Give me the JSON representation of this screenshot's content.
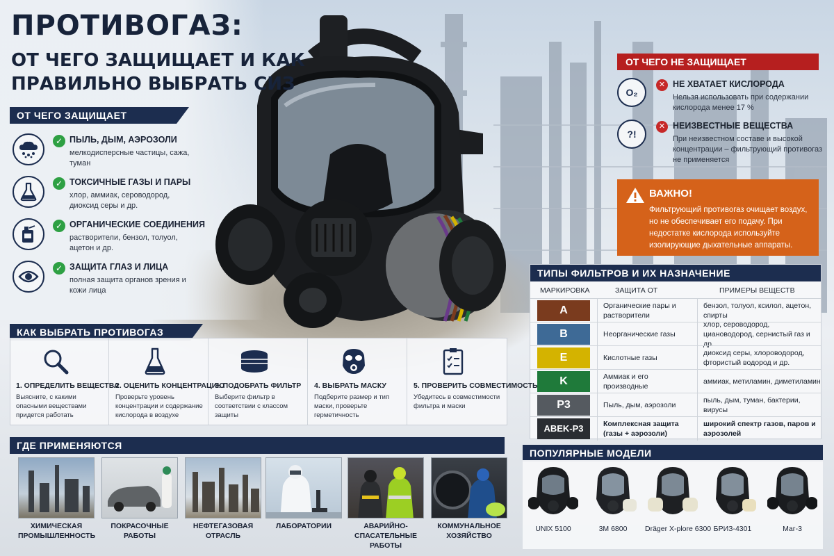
{
  "title": {
    "line1": "ПРОТИВОГАЗ:",
    "line2": "ОТ ЧЕГО ЗАЩИЩАЕТ И КАК",
    "line3": "ПРАВИЛЬНО ВЫБРАТЬ СИЗ"
  },
  "protects": {
    "header": "ОТ ЧЕГО ЗАЩИЩАЕТ",
    "items": [
      {
        "icon": "dust-cloud-icon",
        "title": "ПЫЛЬ, ДЫМ, АЭРОЗОЛИ",
        "desc": "мелкодисперсные частицы, сажа, туман"
      },
      {
        "icon": "flask-icon",
        "title": "ТОКСИЧНЫЕ ГАЗЫ И ПАРЫ",
        "desc": "хлор, аммиак, сероводород, диоксид серы и др."
      },
      {
        "icon": "solvent-can-icon",
        "title": "ОРГАНИЧЕСКИЕ СОЕДИНЕНИЯ",
        "desc": "растворители, бензол, толуол, ацетон и др."
      },
      {
        "icon": "eye-icon",
        "title": "ЗАЩИТА ГЛАЗ И ЛИЦА",
        "desc": "полная защита органов зрения и кожи лица"
      }
    ]
  },
  "not_protects": {
    "header": "ОТ ЧЕГО НЕ ЗАЩИЩАЕТ",
    "items": [
      {
        "icon_text": "O₂",
        "title": "НЕ ХВАТАЕТ КИСЛОРОДА",
        "desc": "Нельзя использовать при содержании кислорода менее 17 %"
      },
      {
        "icon_text": "?!",
        "title": "НЕИЗВЕСТНЫЕ ВЕЩЕСТВА",
        "desc": "При неизвестном составе и высокой концентрации – фильтрующий противогаз не применяется"
      }
    ]
  },
  "warning": {
    "title": "ВАЖНО!",
    "text": "Фильтрующий противогаз очищает воздух, но не обеспечивает его подачу. При недостатке кислорода используйте изолирующие дыхательные аппараты."
  },
  "filters": {
    "header": "ТИПЫ ФИЛЬТРОВ И ИХ НАЗНАЧЕНИЕ",
    "columns": [
      "МАРКИРОВКА",
      "ЗАЩИТА ОТ",
      "ПРИМЕРЫ ВЕЩЕСТВ"
    ],
    "rows": [
      {
        "mark": "A",
        "color": "#7a3b1e",
        "protect": "Органические пары и растворители",
        "examples": "бензол, толуол, ксилол, ацетон, спирты"
      },
      {
        "mark": "B",
        "color": "#3e6a96",
        "protect": "Неорганические газы",
        "examples": "хлор, сероводород, циановодород, сернистый газ и др."
      },
      {
        "mark": "E",
        "color": "#d4b300",
        "protect": "Кислотные газы",
        "examples": "диоксид серы, хлороводород, фтористый водород и др."
      },
      {
        "mark": "K",
        "color": "#1f7a3a",
        "protect": "Аммиак и его производные",
        "examples": "аммиак, метиламин, диметиламин"
      },
      {
        "mark": "P3",
        "color": "#555a60",
        "protect": "Пыль, дым, аэрозоли",
        "examples": "пыль, дым, туман, бактерии, вирусы"
      },
      {
        "mark": "ABEK-P3",
        "color": "#2a2d32",
        "protect": "Комплексная защита (газы + аэрозоли)",
        "examples": "широкий спектр газов, паров и аэрозолей"
      }
    ]
  },
  "choose": {
    "header": "КАК ВЫБРАТЬ ПРОТИВОГАЗ",
    "steps": [
      {
        "icon": "magnifier-icon",
        "title": "1. ОПРЕДЕЛИТЬ ВЕЩЕСТВА",
        "desc": "Выясните, с какими опасными веществами придется работать"
      },
      {
        "icon": "flask-icon",
        "title": "2. ОЦЕНИТЬ КОНЦЕНТРАЦИЮ",
        "desc": "Проверьте уровень концентрации и содержание кислорода в воздухе"
      },
      {
        "icon": "filter-cartridge-icon",
        "title": "3. ПОДОБРАТЬ ФИЛЬТР",
        "desc": "Выберите фильтр в соответствии с классом защиты"
      },
      {
        "icon": "gas-mask-icon",
        "title": "4. ВЫБРАТЬ МАСКУ",
        "desc": "Подберите размер и тип маски, проверьте герметичность"
      },
      {
        "icon": "checklist-icon",
        "title": "5. ПРОВЕРИТЬ СОВМЕСТИМОСТЬ",
        "desc": "Убедитесь в совместимости фильтра и маски"
      }
    ]
  },
  "applied": {
    "header": "ГДЕ ПРИМЕНЯЮТСЯ",
    "items": [
      {
        "label": "ХИМИЧЕСКАЯ ПРОМЫШЛЕННОСТЬ"
      },
      {
        "label": "ПОКРАСОЧНЫЕ РАБОТЫ"
      },
      {
        "label": "НЕФТЕГАЗОВАЯ ОТРАСЛЬ"
      },
      {
        "label": "ЛАБОРАТОРИИ"
      },
      {
        "label": "АВАРИЙНО-СПАСАТЕЛЬНЫЕ РАБОТЫ"
      },
      {
        "label": "КОММУНАЛЬНОЕ ХОЗЯЙСТВО"
      }
    ]
  },
  "models": {
    "header": "ПОПУЛЯРНЫЕ МОДЕЛИ",
    "items": [
      {
        "name": "UNIX 5100"
      },
      {
        "name": "3M 6800"
      },
      {
        "name": "Dräger X-plore 6300"
      },
      {
        "name": "БРИЗ-4301"
      },
      {
        "name": "Маг-3"
      }
    ]
  }
}
